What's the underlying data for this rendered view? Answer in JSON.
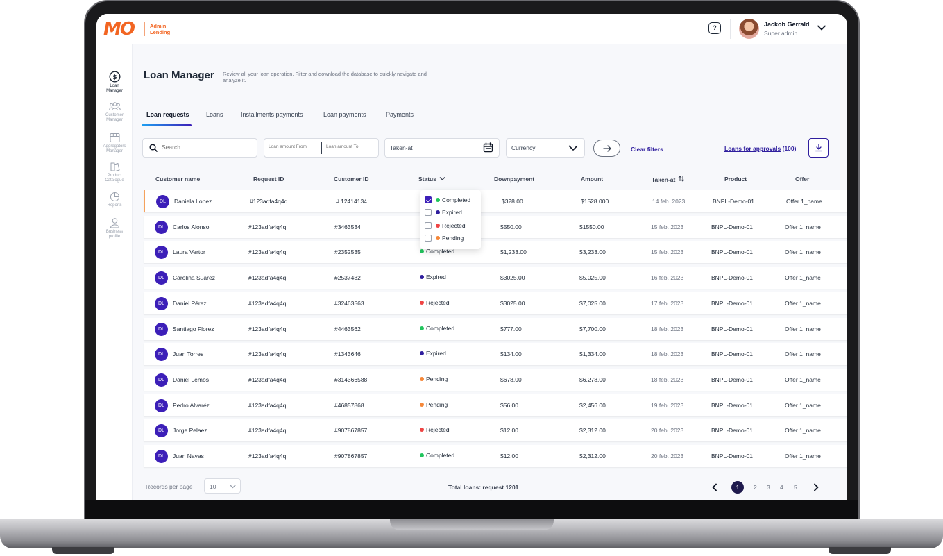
{
  "header": {
    "logo_text": "MO",
    "logo_sub_line1": "Admin",
    "logo_sub_line2": "Lending",
    "user_name": "Jackob Gerrald",
    "user_role": "Super admin"
  },
  "sidebar": {
    "items": [
      {
        "label1": "Loan",
        "label2": "Manager",
        "icon": "dollar-circle-icon"
      },
      {
        "label1": "Customer",
        "label2": "Manager",
        "icon": "users-group-icon"
      },
      {
        "label1": "Aggregators",
        "label2": "Manager",
        "icon": "storefront-icon"
      },
      {
        "label1": "Product",
        "label2": "Catalogue",
        "icon": "catalogue-icon"
      },
      {
        "label1": "Reports",
        "label2": "",
        "icon": "pie-chart-icon"
      },
      {
        "label1": "Business",
        "label2": "profile",
        "icon": "user-icon"
      }
    ]
  },
  "page": {
    "title": "Loan Manager",
    "description": "Review all your loan operation. Filter and download the database to quickly navigate and analyze it."
  },
  "tabs": [
    "Loan requests",
    "Loans",
    "Installments payments",
    "Loan payments",
    "Payments"
  ],
  "filters": {
    "search_placeholder": "Search",
    "amount_from_placeholder": "Loan amount From",
    "amount_to_placeholder": "Loan amount To",
    "taken_at": "Taken-at",
    "currency": "Currency",
    "clear": "Clear filters",
    "approvals_label": "Loans for approvals",
    "approvals_count": "(100)"
  },
  "table": {
    "headers": [
      "Customer name",
      "Request  ID",
      "Customer  ID",
      "Status",
      "Downpayment",
      "Amount",
      "Taken-at",
      "Product",
      "Offer"
    ],
    "rows": [
      {
        "initials": "DL",
        "name": "Daniela Lopez",
        "request_id": "#123adfa4q4q",
        "customer_id": "# 12414134",
        "status": "",
        "downpayment": "$328.00",
        "amount": "$1528.000",
        "taken_at": "14 feb. 2023",
        "product": "BNPL-Demo-01",
        "offer": "Offer 1_name"
      },
      {
        "initials": "DL",
        "name": "Carlos Alonso",
        "request_id": "#123adfa4q4q",
        "customer_id": "#3463534",
        "status": "",
        "downpayment": "$550.00",
        "amount": "$1550.00",
        "taken_at": "15 feb. 2023",
        "product": "BNPL-Demo-01",
        "offer": "Offer 1_name"
      },
      {
        "initials": "DL",
        "name": "Laura Vertor",
        "request_id": "#123adfa4q4q",
        "customer_id": "#2352535",
        "status": "Completed",
        "downpayment": "$1,233.00",
        "amount": "$3,233.00",
        "taken_at": "15 feb. 2023",
        "product": "BNPL-Demo-01",
        "offer": "Offer 1_name"
      },
      {
        "initials": "DL",
        "name": "Carolina Suarez",
        "request_id": "#123adfa4q4q",
        "customer_id": "#2537432",
        "status": "Expired",
        "downpayment": "$3025.00",
        "amount": "$5,025.00",
        "taken_at": "16 feb. 2023",
        "product": "BNPL-Demo-01",
        "offer": "Offer 1_name"
      },
      {
        "initials": "DL",
        "name": "Daniel Pérez",
        "request_id": "#123adfa4q4q",
        "customer_id": "#32463563",
        "status": "Rejected",
        "downpayment": "$3025.00",
        "amount": "$7,025.00",
        "taken_at": "17 feb. 2023",
        "product": "BNPL-Demo-01",
        "offer": "Offer 1_name"
      },
      {
        "initials": "DL",
        "name": "Santiago Florez",
        "request_id": "#123adfa4q4q",
        "customer_id": "#4463562",
        "status": "Completed",
        "downpayment": "$777.00",
        "amount": "$7,700.00",
        "taken_at": "18 feb. 2023",
        "product": "BNPL-Demo-01",
        "offer": "Offer 1_name"
      },
      {
        "initials": "DL",
        "name": "Juan Torres",
        "request_id": "#123adfa4q4q",
        "customer_id": "#1343646",
        "status": "Expired",
        "downpayment": "$134.00",
        "amount": "$1,334.00",
        "taken_at": "18 feb. 2023",
        "product": "BNPL-Demo-01",
        "offer": "Offer 1_name"
      },
      {
        "initials": "DL",
        "name": "Daniel Lemos",
        "request_id": "#123adfa4q4q",
        "customer_id": "#314366588",
        "status": "Pending",
        "downpayment": "$678.00",
        "amount": "$6,278.00",
        "taken_at": "18 feb. 2023",
        "product": "BNPL-Demo-01",
        "offer": "Offer 1_name"
      },
      {
        "initials": "DL",
        "name": "Pedro Alvaréz",
        "request_id": "#123adfa4q4q",
        "customer_id": "#46857868",
        "status": "Pending",
        "downpayment": "$56.00",
        "amount": "$2,456.00",
        "taken_at": "19 feb. 2023",
        "product": "BNPL-Demo-01",
        "offer": "Offer 1_name"
      },
      {
        "initials": "DL",
        "name": "Jorge Pelaez",
        "request_id": "#123adfa4q4q",
        "customer_id": "#907867857",
        "status": "Rejected",
        "downpayment": "$12.00",
        "amount": "$2,312.00",
        "taken_at": "20 feb. 2023",
        "product": "BNPL-Demo-01",
        "offer": "Offer 1_name"
      },
      {
        "initials": "DL",
        "name": "Juan Navas",
        "request_id": "#123adfa4q4q",
        "customer_id": "#907867857",
        "status": "Completed",
        "downpayment": "$12.00",
        "amount": "$2,312.00",
        "taken_at": "20 feb. 2023",
        "product": "BNPL-Demo-01",
        "offer": "Offer 1_name"
      }
    ]
  },
  "status_filter": {
    "options": [
      {
        "label": "Completed",
        "checked": true
      },
      {
        "label": "Expired",
        "checked": false
      },
      {
        "label": "Rejected",
        "checked": false
      },
      {
        "label": "Pending",
        "checked": false
      }
    ]
  },
  "status_colors": {
    "Completed": "#22c55e",
    "Expired": "#2f1e9e",
    "Rejected": "#ef4444",
    "Pending": "#f5883a"
  },
  "footer": {
    "records_label": "Records per page",
    "records_value": "10",
    "total": "Total loans: request 1201",
    "pages": [
      "1",
      "2",
      "3",
      "4",
      "5"
    ],
    "current_page": "1"
  },
  "colors": {
    "brand": "#f26522",
    "primary": "#3c1fb8",
    "link": "#2f1e9e"
  }
}
